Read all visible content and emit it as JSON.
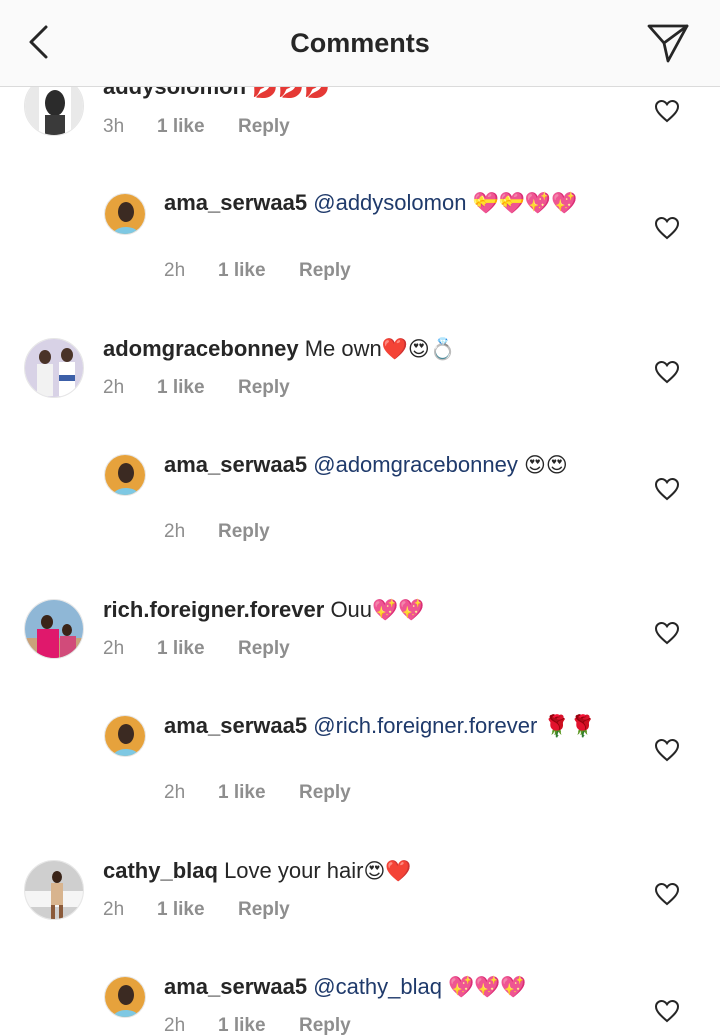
{
  "header": {
    "title": "Comments"
  },
  "comments": [
    {
      "kind": "top",
      "username": "addysolomon",
      "text": "",
      "emoji": "💋💋💋",
      "time": "3h",
      "likes": "1 like",
      "reply": "Reply"
    },
    {
      "kind": "reply",
      "username": "ama_serwaa5",
      "mention": "@addysolomon",
      "text": "",
      "emoji": "💝💝💖💖",
      "time": "2h",
      "likes": "1 like",
      "reply": "Reply"
    },
    {
      "kind": "top",
      "username": "adomgracebonney",
      "text": "Me own",
      "emoji": "❤️😍💍",
      "time": "2h",
      "likes": "1 like",
      "reply": "Reply"
    },
    {
      "kind": "reply",
      "username": "ama_serwaa5",
      "mention": "@adomgracebonney",
      "text": "",
      "emoji": "😍😍",
      "time": "2h",
      "likes": "",
      "reply": "Reply"
    },
    {
      "kind": "top",
      "username": "rich.foreigner.forever",
      "text": "Ouu",
      "emoji": "💖💖",
      "time": "2h",
      "likes": "1 like",
      "reply": "Reply"
    },
    {
      "kind": "reply",
      "username": "ama_serwaa5",
      "mention": "@rich.foreigner.forever",
      "text": "",
      "emoji": "🌹🌹",
      "time": "2h",
      "likes": "1 like",
      "reply": "Reply"
    },
    {
      "kind": "top",
      "username": "cathy_blaq",
      "text": "Love your hair",
      "emoji": "😍❤️",
      "time": "2h",
      "likes": "1 like",
      "reply": "Reply"
    },
    {
      "kind": "reply",
      "username": "ama_serwaa5",
      "mention": "@cathy_blaq",
      "text": "",
      "emoji": "💖💖💖",
      "time": "2h",
      "likes": "1 like",
      "reply": "Reply"
    }
  ],
  "icons": {
    "back": "chevron-left-icon",
    "send": "paper-plane-icon",
    "like": "heart-outline-icon"
  },
  "colors": {
    "mention": "#1f3a6b",
    "meta": "#8e8e8e",
    "text": "#262626",
    "header_bg": "#fafafa"
  }
}
